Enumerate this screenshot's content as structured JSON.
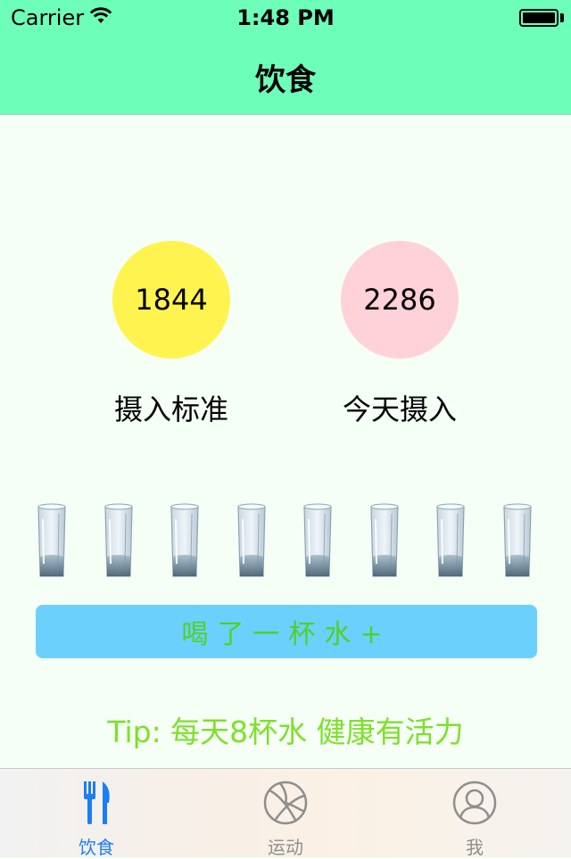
{
  "status_bar": {
    "carrier": "Carrier",
    "time": "1:48 PM"
  },
  "nav": {
    "title": "饮食"
  },
  "intake": {
    "standard": {
      "value": "1844",
      "label": "摄入标准",
      "color": "#fff44f"
    },
    "today": {
      "value": "2286",
      "label": "今天摄入",
      "color": "#ffd1d9"
    }
  },
  "water": {
    "glass_count": 8,
    "button_label": "喝了一杯水+",
    "tip": "Tip: 每天8杯水 健康有活力"
  },
  "tabs": [
    {
      "label": "饮食",
      "icon": "fork-knife-icon",
      "active": true
    },
    {
      "label": "运动",
      "icon": "basketball-icon",
      "active": false
    },
    {
      "label": "我",
      "icon": "person-icon",
      "active": false
    }
  ],
  "colors": {
    "header": "#6dffb9",
    "button": "#6cd0fc",
    "button_text": "#4fd12a",
    "tip_text": "#7ee02b",
    "tab_active": "#1a7ef5"
  }
}
